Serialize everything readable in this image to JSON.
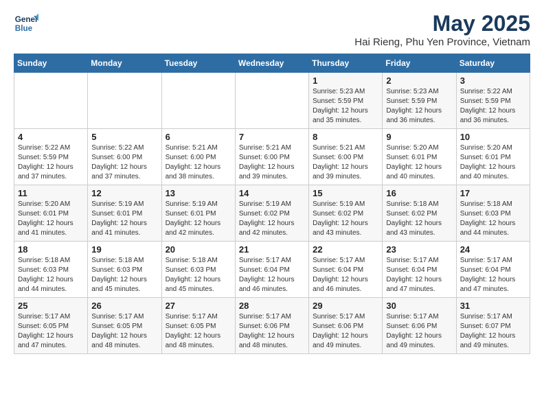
{
  "header": {
    "logo_line1": "General",
    "logo_line2": "Blue",
    "month": "May 2025",
    "location": "Hai Rieng, Phu Yen Province, Vietnam"
  },
  "days_of_week": [
    "Sunday",
    "Monday",
    "Tuesday",
    "Wednesday",
    "Thursday",
    "Friday",
    "Saturday"
  ],
  "weeks": [
    [
      {
        "day": "",
        "info": ""
      },
      {
        "day": "",
        "info": ""
      },
      {
        "day": "",
        "info": ""
      },
      {
        "day": "",
        "info": ""
      },
      {
        "day": "1",
        "info": "Sunrise: 5:23 AM\nSunset: 5:59 PM\nDaylight: 12 hours\nand 35 minutes."
      },
      {
        "day": "2",
        "info": "Sunrise: 5:23 AM\nSunset: 5:59 PM\nDaylight: 12 hours\nand 36 minutes."
      },
      {
        "day": "3",
        "info": "Sunrise: 5:22 AM\nSunset: 5:59 PM\nDaylight: 12 hours\nand 36 minutes."
      }
    ],
    [
      {
        "day": "4",
        "info": "Sunrise: 5:22 AM\nSunset: 5:59 PM\nDaylight: 12 hours\nand 37 minutes."
      },
      {
        "day": "5",
        "info": "Sunrise: 5:22 AM\nSunset: 6:00 PM\nDaylight: 12 hours\nand 37 minutes."
      },
      {
        "day": "6",
        "info": "Sunrise: 5:21 AM\nSunset: 6:00 PM\nDaylight: 12 hours\nand 38 minutes."
      },
      {
        "day": "7",
        "info": "Sunrise: 5:21 AM\nSunset: 6:00 PM\nDaylight: 12 hours\nand 39 minutes."
      },
      {
        "day": "8",
        "info": "Sunrise: 5:21 AM\nSunset: 6:00 PM\nDaylight: 12 hours\nand 39 minutes."
      },
      {
        "day": "9",
        "info": "Sunrise: 5:20 AM\nSunset: 6:01 PM\nDaylight: 12 hours\nand 40 minutes."
      },
      {
        "day": "10",
        "info": "Sunrise: 5:20 AM\nSunset: 6:01 PM\nDaylight: 12 hours\nand 40 minutes."
      }
    ],
    [
      {
        "day": "11",
        "info": "Sunrise: 5:20 AM\nSunset: 6:01 PM\nDaylight: 12 hours\nand 41 minutes."
      },
      {
        "day": "12",
        "info": "Sunrise: 5:19 AM\nSunset: 6:01 PM\nDaylight: 12 hours\nand 41 minutes."
      },
      {
        "day": "13",
        "info": "Sunrise: 5:19 AM\nSunset: 6:01 PM\nDaylight: 12 hours\nand 42 minutes."
      },
      {
        "day": "14",
        "info": "Sunrise: 5:19 AM\nSunset: 6:02 PM\nDaylight: 12 hours\nand 42 minutes."
      },
      {
        "day": "15",
        "info": "Sunrise: 5:19 AM\nSunset: 6:02 PM\nDaylight: 12 hours\nand 43 minutes."
      },
      {
        "day": "16",
        "info": "Sunrise: 5:18 AM\nSunset: 6:02 PM\nDaylight: 12 hours\nand 43 minutes."
      },
      {
        "day": "17",
        "info": "Sunrise: 5:18 AM\nSunset: 6:03 PM\nDaylight: 12 hours\nand 44 minutes."
      }
    ],
    [
      {
        "day": "18",
        "info": "Sunrise: 5:18 AM\nSunset: 6:03 PM\nDaylight: 12 hours\nand 44 minutes."
      },
      {
        "day": "19",
        "info": "Sunrise: 5:18 AM\nSunset: 6:03 PM\nDaylight: 12 hours\nand 45 minutes."
      },
      {
        "day": "20",
        "info": "Sunrise: 5:18 AM\nSunset: 6:03 PM\nDaylight: 12 hours\nand 45 minutes."
      },
      {
        "day": "21",
        "info": "Sunrise: 5:17 AM\nSunset: 6:04 PM\nDaylight: 12 hours\nand 46 minutes."
      },
      {
        "day": "22",
        "info": "Sunrise: 5:17 AM\nSunset: 6:04 PM\nDaylight: 12 hours\nand 46 minutes."
      },
      {
        "day": "23",
        "info": "Sunrise: 5:17 AM\nSunset: 6:04 PM\nDaylight: 12 hours\nand 47 minutes."
      },
      {
        "day": "24",
        "info": "Sunrise: 5:17 AM\nSunset: 6:04 PM\nDaylight: 12 hours\nand 47 minutes."
      }
    ],
    [
      {
        "day": "25",
        "info": "Sunrise: 5:17 AM\nSunset: 6:05 PM\nDaylight: 12 hours\nand 47 minutes."
      },
      {
        "day": "26",
        "info": "Sunrise: 5:17 AM\nSunset: 6:05 PM\nDaylight: 12 hours\nand 48 minutes."
      },
      {
        "day": "27",
        "info": "Sunrise: 5:17 AM\nSunset: 6:05 PM\nDaylight: 12 hours\nand 48 minutes."
      },
      {
        "day": "28",
        "info": "Sunrise: 5:17 AM\nSunset: 6:06 PM\nDaylight: 12 hours\nand 48 minutes."
      },
      {
        "day": "29",
        "info": "Sunrise: 5:17 AM\nSunset: 6:06 PM\nDaylight: 12 hours\nand 49 minutes."
      },
      {
        "day": "30",
        "info": "Sunrise: 5:17 AM\nSunset: 6:06 PM\nDaylight: 12 hours\nand 49 minutes."
      },
      {
        "day": "31",
        "info": "Sunrise: 5:17 AM\nSunset: 6:07 PM\nDaylight: 12 hours\nand 49 minutes."
      }
    ]
  ]
}
